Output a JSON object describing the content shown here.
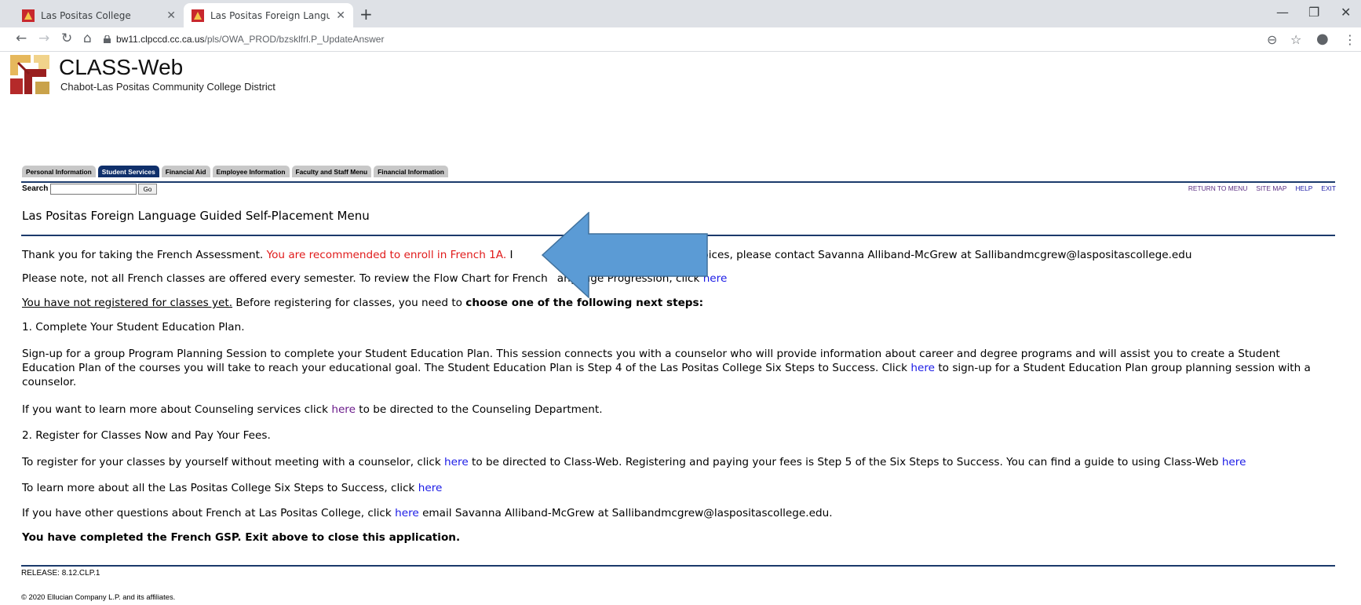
{
  "browser": {
    "tabs": [
      {
        "title": "Las Positas College",
        "active": false
      },
      {
        "title": "Las Positas Foreign Language Gu",
        "active": true
      }
    ],
    "url_host": "bw11.clpccd.cc.ca.us",
    "url_path": "/pls/OWA_PROD/bzsklfrl.P_UpdateAnswer"
  },
  "header": {
    "brand": "CLASS-Web",
    "subtitle": "Chabot-Las Positas Community College District"
  },
  "menu_tabs": [
    "Personal Information",
    "Student Services",
    "Financial Aid",
    "Employee Information",
    "Faculty and Staff Menu",
    "Financial Information"
  ],
  "search": {
    "label": "Search",
    "go": "Go"
  },
  "top_links": [
    "RETURN TO MENU",
    "SITE MAP",
    "HELP",
    "EXIT"
  ],
  "page_title": "Las Positas Foreign Language Guided Self-Placement Menu",
  "content": {
    "p1_a": "Thank you for taking the French Assessment. ",
    "p1_red": "You are recommended to enroll in French 1A.",
    "p1_b": " I",
    "p1_c": "our choices, please contact Savanna Alliband-McGrew at Sallibandmcgrew@laspositascollege.edu",
    "p2_a": "Please note, not all French classes are offered every semester. To review the Flow Chart for French",
    "p2_b": "anguage Progression, click ",
    "here": "here",
    "p3_u": "You have not registered for classes yet.",
    "p3_a": " Before registering for classes, you need to ",
    "p3_b": "choose one of the following next steps:",
    "step1": "1. Complete Your Student Education Plan.",
    "p4_a": "Sign-up for a group Program Planning Session to complete your Student Education Plan. This session connects you with a counselor who will provide information about career and degree programs and will assist you to create a Student Education Plan of the courses you will take to reach your educational goal. The Student Education Plan is Step 4 of the Las Positas College Six Steps to Success. Click ",
    "p4_b": " to sign-up for a Student Education Plan group planning session with a counselor.",
    "p5_a": "If you want to learn more about Counseling services click ",
    "p5_b": " to be directed to the Counseling Department.",
    "step2": "2. Register for Classes Now and Pay Your Fees.",
    "p6_a": "To register for your classes by yourself without meeting with a counselor, click ",
    "p6_b": " to be directed to Class-Web. Registering and paying your fees is Step 5 of the Six Steps to Success. You can find a guide to using Class-Web ",
    "p7_a": "To learn more about all the Las Positas College Six Steps to Success, click ",
    "p8_a": "If you have other questions about French at Las Positas College, click ",
    "p8_b": " email Savanna Alliband-McGrew at Sallibandmcgrew@laspositascollege.edu.",
    "p9": "You have completed the French GSP. Exit above to close this application."
  },
  "footer": {
    "release": "RELEASE: 8.12.CLP.1",
    "copyright": "© 2020 Ellucian Company L.P. and its affiliates."
  },
  "colors": {
    "arrow": "#5b9bd5",
    "nav_blue": "#1b3a6b",
    "recommend_red": "#e01a1a"
  }
}
